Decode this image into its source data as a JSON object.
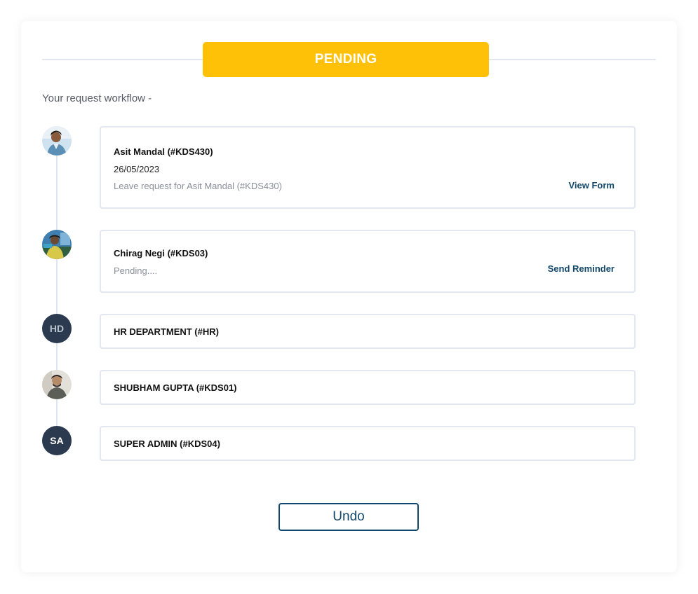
{
  "status": {
    "label": "PENDING",
    "color": "#ffc107"
  },
  "workflow_heading": "Your request workflow -",
  "steps": [
    {
      "avatar": {
        "type": "photo",
        "icon": "user-photo-icon"
      },
      "name": "Asit Mandal (#KDS430)",
      "date": "26/05/2023",
      "description": "Leave request for Asit Mandal (#KDS430)",
      "action": "View Form"
    },
    {
      "avatar": {
        "type": "photo",
        "icon": "user-photo-icon"
      },
      "name": "Chirag Negi (#KDS03)",
      "description": "Pending....",
      "action": "Send Reminder"
    },
    {
      "avatar": {
        "type": "initials",
        "initials": "HD"
      },
      "name": "HR DEPARTMENT (#HR)"
    },
    {
      "avatar": {
        "type": "photo",
        "icon": "user-photo-icon"
      },
      "name": "SHUBHAM GUPTA (#KDS01)"
    },
    {
      "avatar": {
        "type": "initials",
        "initials": "SA"
      },
      "name": "SUPER ADMIN (#KDS04)"
    }
  ],
  "undo_label": "Undo",
  "colors": {
    "accent": "#12476b",
    "avatar_bg": "#2c3a4f",
    "card_border": "#e4e6f2"
  }
}
